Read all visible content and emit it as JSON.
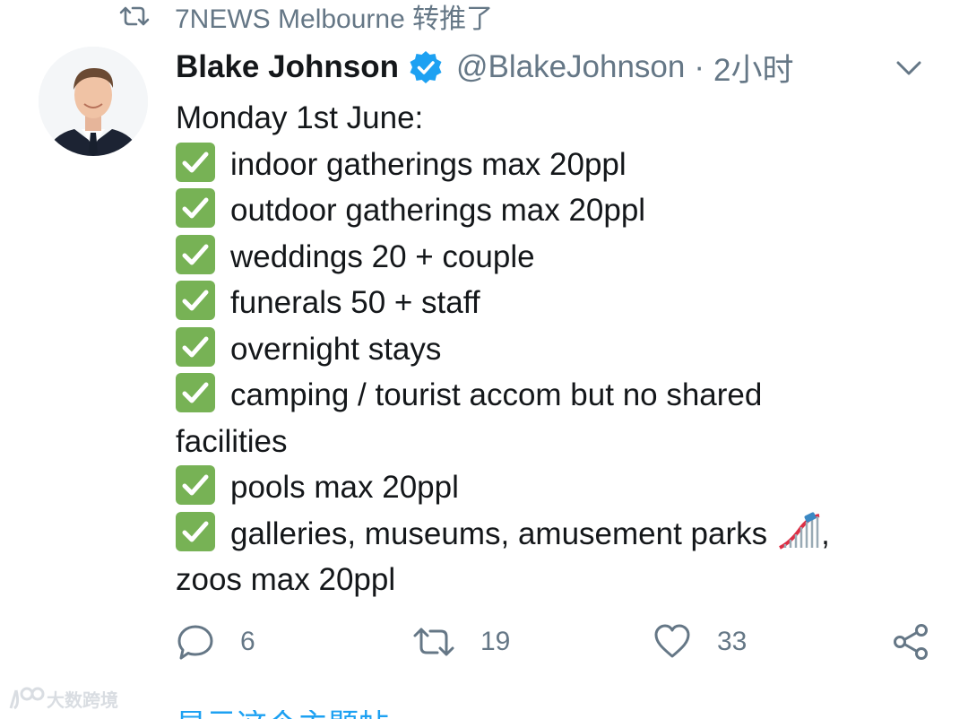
{
  "retweet": {
    "label": "7NEWS Melbourne 转推了",
    "icon": "retweet-icon"
  },
  "author": {
    "name": "Blake Johnson",
    "handle": "@BlakeJohnson",
    "separator": "·",
    "time": "2小时",
    "verified": true
  },
  "tweet": {
    "intro": "Monday 1st June:",
    "items": [
      "indoor gatherings max 20ppl",
      "outdoor gatherings max 20ppl",
      "weddings 20 + couple",
      "funerals 50 + staff",
      "overnight stays",
      "camping / tourist accom but no shared",
      "pools max 20ppl",
      "galleries, museums, amusement parks"
    ],
    "item6_continuation": "facilities",
    "item8_suffix": ",",
    "item8_continuation": "zoos max 20ppl"
  },
  "actions": {
    "replies": "6",
    "retweets": "19",
    "likes": "33"
  },
  "watermark": {
    "text": "大数跨境"
  },
  "below": {
    "partial_text": "显示这个主题帖"
  },
  "colors": {
    "accent": "#1da1f2",
    "muted": "#657786",
    "check_green": "#77b255"
  }
}
